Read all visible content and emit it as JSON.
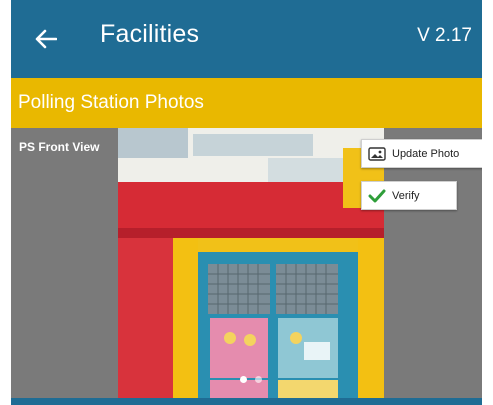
{
  "appbar": {
    "title": "Facilities",
    "version": "V 2.17",
    "back_icon": "arrow-left-icon"
  },
  "section": {
    "title": "Polling Station Photos"
  },
  "photo": {
    "label": "PS Front View",
    "update_label": "Update Photo",
    "update_icon": "image-icon",
    "verify_label": "Verify",
    "verify_icon": "checkmark-icon",
    "carousel_pages": 2,
    "carousel_current": 1
  },
  "colors": {
    "appbar": "#1f6c94",
    "section_band": "#e9b800",
    "photo_background": "#7a7a7a",
    "verify_check": "#2f9e3a"
  }
}
